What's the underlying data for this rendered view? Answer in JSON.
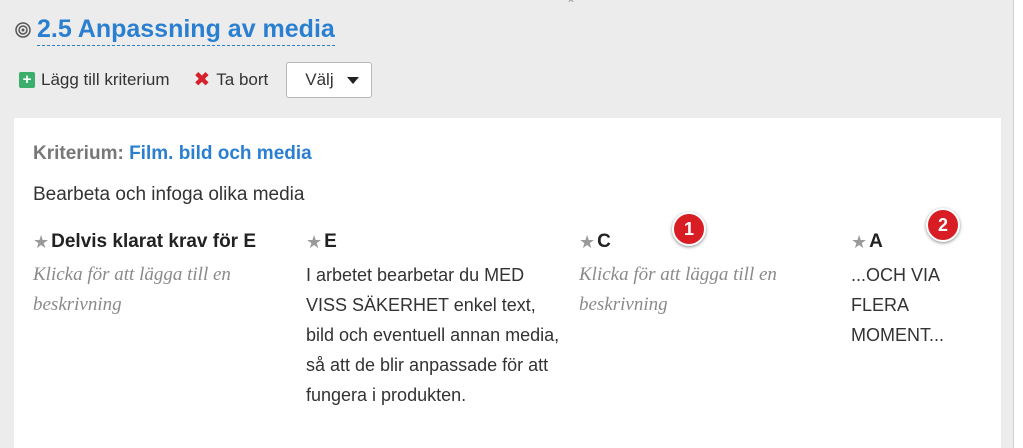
{
  "section": {
    "title": "2.5 Anpassning av media",
    "icon": "target-icon"
  },
  "toolbar": {
    "add_label": "Lägg till kriterium",
    "delete_label": "Ta bort",
    "select_value": "Välj"
  },
  "criterion": {
    "label": "Kriterium:",
    "name": "Film. bild och media",
    "description": "Bearbeta och infoga olika media"
  },
  "levels": [
    {
      "heading": "Delvis klarat krav för E",
      "body": "Klicka för att lägga till en beskrivning",
      "placeholder": true
    },
    {
      "heading": "E",
      "body": "I arbetet bearbetar du MED VISS SÄKERHET enkel text, bild och eventuell annan media, så att de blir anpassade för att fungera i produkten.",
      "placeholder": false
    },
    {
      "heading": "C",
      "body": "Klicka för att lägga till en beskrivning",
      "placeholder": true
    },
    {
      "heading": "A",
      "body": "...OCH VIA FLERA MOMENT...",
      "placeholder": false
    }
  ],
  "badges": [
    "1",
    "2"
  ],
  "colors": {
    "link": "#2a7fd0",
    "add": "#3aae6a",
    "delete": "#d8202a",
    "badge": "#d81e24",
    "frame": "#ececec"
  }
}
